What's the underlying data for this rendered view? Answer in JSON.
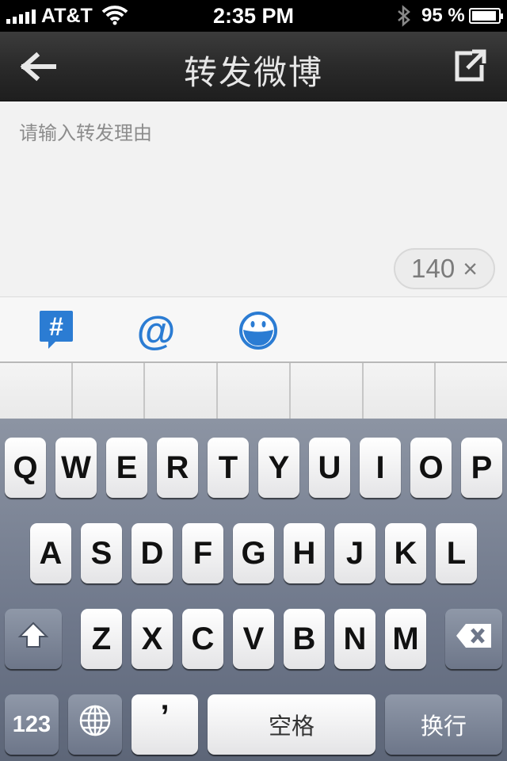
{
  "status_bar": {
    "carrier": "AT&T",
    "time": "2:35 PM",
    "battery_percent": "95 %",
    "battery_level": 0.95,
    "icons": [
      "signal-icon",
      "wifi-icon",
      "bluetooth-icon",
      "battery-icon"
    ]
  },
  "nav": {
    "title": "转发微博",
    "back_icon": "back-arrow-icon",
    "share_icon": "share-external-icon"
  },
  "compose": {
    "placeholder": "请输入转发理由",
    "value": "",
    "char_count": "140",
    "clear_label": "×"
  },
  "toolbar": {
    "tools": [
      {
        "icon": "hashtag-icon",
        "label": "#"
      },
      {
        "icon": "mention-icon",
        "label": "@"
      },
      {
        "icon": "emoji-icon"
      }
    ],
    "accent_color": "#2b7cd3"
  },
  "keyboard": {
    "row1": [
      "Q",
      "W",
      "E",
      "R",
      "T",
      "Y",
      "U",
      "I",
      "O",
      "P"
    ],
    "row2": [
      "A",
      "S",
      "D",
      "F",
      "G",
      "H",
      "J",
      "K",
      "L"
    ],
    "row3": [
      "Z",
      "X",
      "C",
      "V",
      "B",
      "N",
      "M"
    ],
    "shift_icon": "shift-icon",
    "delete_icon": "backspace-icon",
    "numbers_label": "123",
    "globe_icon": "globe-icon",
    "apostrophe_label": "’",
    "space_label": "空格",
    "return_label": "换行"
  }
}
